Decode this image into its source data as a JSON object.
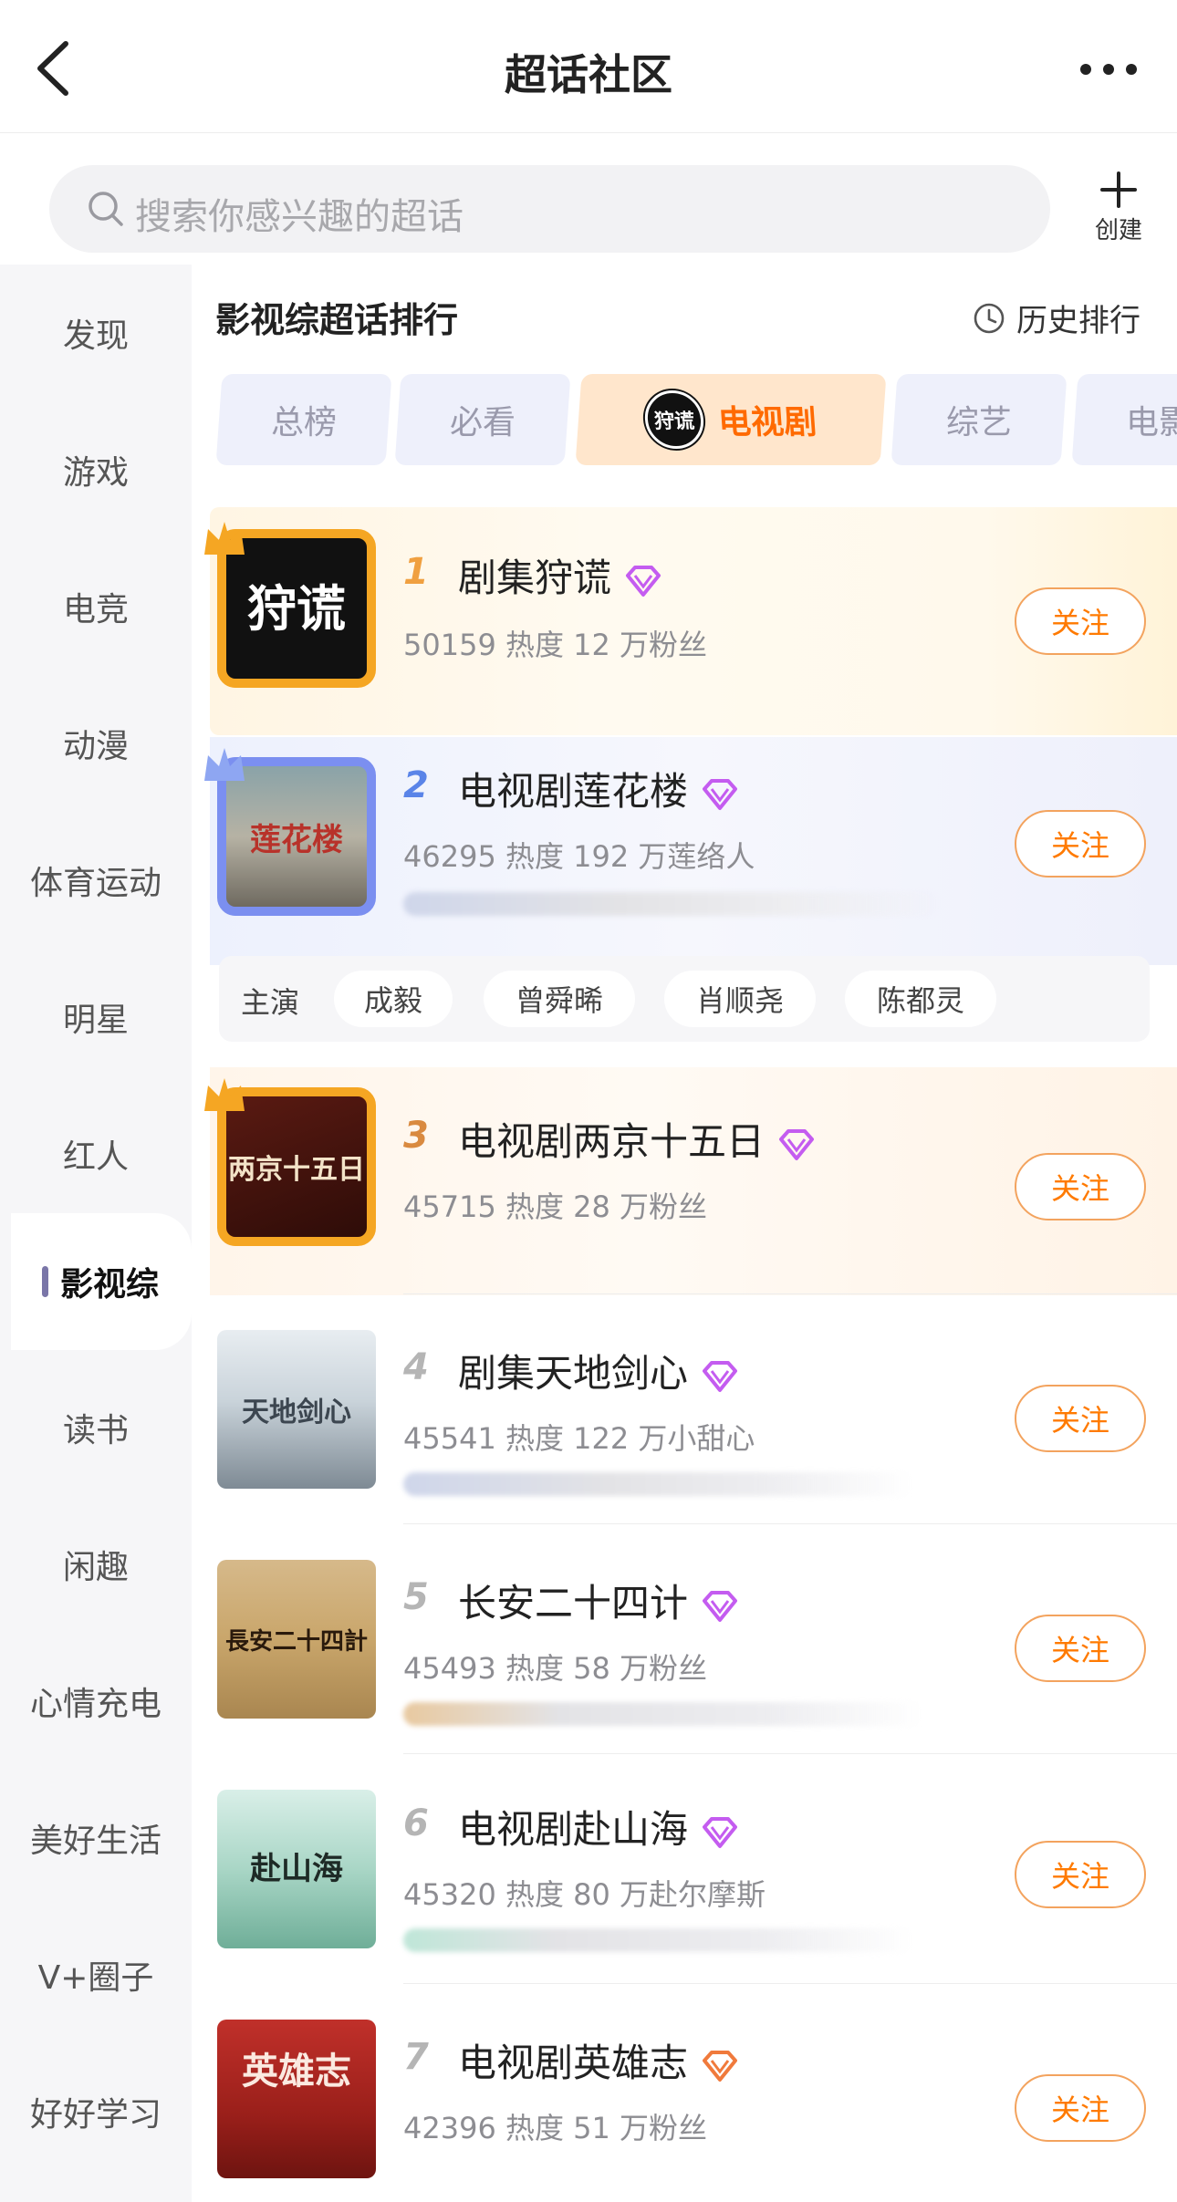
{
  "header": {
    "title": "超话社区"
  },
  "search": {
    "placeholder": "搜索你感兴趣的超话"
  },
  "create": {
    "label": "创建"
  },
  "sidebar": {
    "items": [
      {
        "label": "发现"
      },
      {
        "label": "游戏"
      },
      {
        "label": "电竞"
      },
      {
        "label": "动漫"
      },
      {
        "label": "体育运动"
      },
      {
        "label": "明星"
      },
      {
        "label": "红人"
      },
      {
        "label": "影视综",
        "active": true
      },
      {
        "label": "读书"
      },
      {
        "label": "闲趣"
      },
      {
        "label": "心情充电"
      },
      {
        "label": "美好生活"
      },
      {
        "label": "V+圈子"
      },
      {
        "label": "好好学习"
      }
    ]
  },
  "main": {
    "section_title": "影视综超话排行",
    "history_label": "历史排行",
    "tabs": [
      {
        "label": "总榜"
      },
      {
        "label": "必看"
      },
      {
        "label": "电视剧",
        "badge": "狩谎",
        "active": true
      },
      {
        "label": "综艺"
      },
      {
        "label": "电影"
      }
    ],
    "follow_label": "关注",
    "rows": [
      {
        "rank": "1",
        "name": "剧集狩谎",
        "meta": "50159 热度 12 万粉丝",
        "poster_text": "狩谎",
        "gem_color": "#c45cf0"
      },
      {
        "rank": "2",
        "name": "电视剧莲花楼",
        "meta": "46295 热度 192 万莲络人",
        "poster_text": "莲花楼",
        "gem_color": "#c45cf0"
      },
      {
        "rank": "3",
        "name": "电视剧两京十五日",
        "meta": "45715 热度 28 万粉丝",
        "poster_text": "两京十五日",
        "gem_color": "#c45cf0"
      },
      {
        "rank": "4",
        "name": "剧集天地剑心",
        "meta": "45541 热度 122 万小甜心",
        "poster_text": "天地剑心",
        "gem_color": "#c45cf0"
      },
      {
        "rank": "5",
        "name": "长安二十四计",
        "meta": "45493 热度 58 万粉丝",
        "poster_text": "長安二十四計",
        "gem_color": "#c45cf0"
      },
      {
        "rank": "6",
        "name": "电视剧赴山海",
        "meta": "45320 热度 80 万赴尔摩斯",
        "poster_text": "赴山海",
        "gem_color": "#c45cf0"
      },
      {
        "rank": "7",
        "name": "电视剧英雄志",
        "meta": "42396 热度 51 万粉丝",
        "poster_text": "英雄志",
        "gem_color": "#f07a3c"
      }
    ],
    "cast": {
      "label": "主演",
      "names": [
        "成毅",
        "曾舜晞",
        "肖顺尧",
        "陈都灵"
      ]
    }
  },
  "colors": {
    "accent": "#ff7a00",
    "follow_border": "#f3a35e",
    "gold_frame": "#f5a623",
    "blue_frame": "#7b8ff0",
    "rank_gold": "#f0a040",
    "rank_blue": "#5a84e8",
    "rank_bronze": "#d98a40",
    "rank_gray": "#b5b5b5"
  }
}
